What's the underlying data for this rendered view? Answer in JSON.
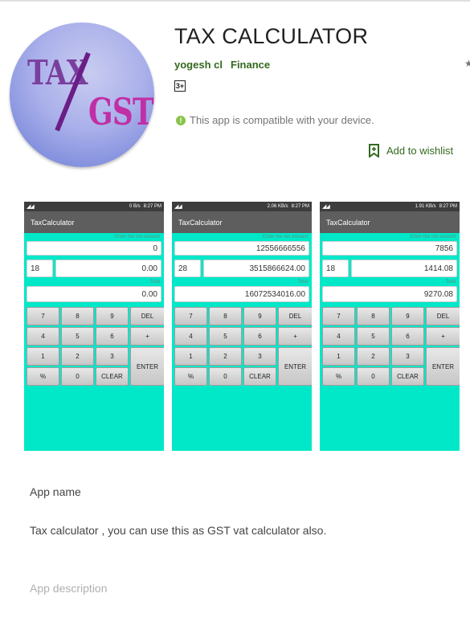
{
  "app": {
    "title": "TAX CALCULATOR",
    "developer": "yogesh cl",
    "category": "Finance",
    "content_rating": "3+",
    "compatibility": "This app is compatible with your device.",
    "wishlist_label": "Add to wishlist",
    "star_glyph": "★",
    "compat_glyph": "!",
    "icon": {
      "text_top": "TAX",
      "text_bottom": "GST",
      "colors": [
        "#7a3f9e",
        "#c02fa5",
        "#aab0ea"
      ]
    }
  },
  "screenshots": [
    {
      "status_signal": "◢◢",
      "status_speed": "0 B/s",
      "status_time": "8:27 PM",
      "app_bar_title": "TaxCalculator",
      "net_hint": "Enter the net amount",
      "net_amount": "0",
      "rate": "18",
      "tax_amount": "0.00",
      "total_hint": "Total",
      "total": "0.00"
    },
    {
      "status_signal": "◢◢",
      "status_speed": "2.06 KB/s",
      "status_time": "8:27 PM",
      "app_bar_title": "TaxCalculator",
      "net_hint": "Enter the net amount",
      "net_amount": "12556666556",
      "rate": "28",
      "tax_amount": "3515866624.00",
      "total_hint": "Total",
      "total": "16072534016.00"
    },
    {
      "status_signal": "◢◢",
      "status_speed": "1.91 KB/s",
      "status_time": "8:27 PM",
      "app_bar_title": "TaxCalculator",
      "net_hint": "Enter the net amount",
      "net_amount": "7856",
      "rate": "18",
      "tax_amount": "1414.08",
      "total_hint": "Total",
      "total": "9270.08"
    }
  ],
  "keypad": {
    "k7": "7",
    "k8": "8",
    "k9": "9",
    "del": "DEL",
    "k4": "4",
    "k5": "5",
    "k6": "6",
    "plus": "+",
    "k1": "1",
    "k2": "2",
    "k3": "3",
    "enter": "ENTER",
    "percent": "%",
    "k0": "0",
    "clear": "CLEAR"
  },
  "details": {
    "app_name_label": "App name",
    "app_name_value": "Tax calculator , you can use this as GST vat calculator also.",
    "app_description_label": "App description"
  },
  "colors": {
    "accent_green": "#33691e",
    "calculator_bg": "#00e8c8",
    "app_bar": "#5e5e5e"
  }
}
